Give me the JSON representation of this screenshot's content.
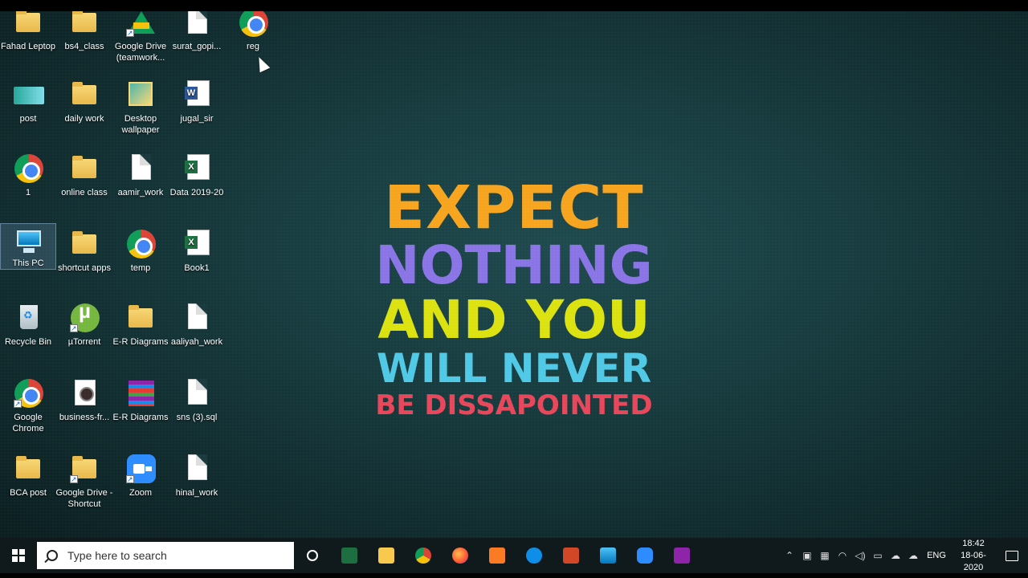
{
  "desktop_icons": [
    {
      "label": "Fahad Leptop",
      "icon": "folder-user-icon"
    },
    {
      "label": "bs4_class",
      "icon": "folder-icon"
    },
    {
      "label": "Google Drive (teamwork...",
      "icon": "google-drive-icon"
    },
    {
      "label": "surat_gopi...",
      "icon": "file-icon"
    },
    {
      "label": "reg",
      "icon": "chrome-icon"
    },
    {
      "label": "post",
      "icon": "postcard-icon"
    },
    {
      "label": "daily work",
      "icon": "folder-icon"
    },
    {
      "label": "Desktop wallpaper",
      "icon": "wallpaper-folder-icon"
    },
    {
      "label": "jugal_sir",
      "icon": "word-icon"
    },
    {
      "label": "1",
      "icon": "chrome-icon"
    },
    {
      "label": "online class",
      "icon": "folder-icon"
    },
    {
      "label": "aamir_work",
      "icon": "file-icon"
    },
    {
      "label": "Data 2019-20",
      "icon": "excel-icon"
    },
    {
      "label": "This PC",
      "icon": "this-pc-icon"
    },
    {
      "label": "shortcut apps",
      "icon": "folder-icon"
    },
    {
      "label": "temp",
      "icon": "chrome-icon"
    },
    {
      "label": "Book1",
      "icon": "excel-icon"
    },
    {
      "label": "Recycle Bin",
      "icon": "recycle-bin-icon"
    },
    {
      "label": "µTorrent",
      "icon": "utorrent-icon"
    },
    {
      "label": "E-R Diagrams",
      "icon": "folder-icon"
    },
    {
      "label": "aaliyah_work",
      "icon": "file-icon"
    },
    {
      "label": "Google Chrome",
      "icon": "chrome-icon"
    },
    {
      "label": "business-fr...",
      "icon": "media-file-icon"
    },
    {
      "label": "E-R Diagrams",
      "icon": "winrar-icon"
    },
    {
      "label": "sns (3).sql",
      "icon": "file-icon"
    },
    {
      "label": "BCA post",
      "icon": "folder-icon"
    },
    {
      "label": "Google Drive - Shortcut",
      "icon": "google-drive-icon"
    },
    {
      "label": "Zoom",
      "icon": "zoom-icon"
    },
    {
      "label": "hinal_work",
      "icon": "file-icon"
    }
  ],
  "wallpaper": {
    "line1": "EXPECT",
    "line2": "NOTHING",
    "line3": "AND YOU",
    "line4": "WILL NEVER",
    "line5": "BE DISSAPOINTED"
  },
  "taskbar": {
    "search_placeholder": "Type here to search",
    "pinned_apps": [
      "cortana-icon",
      "excel-app-icon",
      "file-explorer-icon",
      "chrome-icon",
      "firefox-icon",
      "xampp-icon",
      "teamviewer-icon",
      "powerpoint-icon",
      "photos-icon",
      "zoom-icon",
      "gsuite-icon"
    ],
    "language": "ENG",
    "time": "18:42",
    "date": "18-06-2020"
  },
  "colors": {
    "expect": "#f7a51e",
    "nothing": "#8a74e6",
    "and_you": "#dce20f",
    "will_never": "#4fc9e6",
    "be_dissapointed": "#e8465a"
  }
}
